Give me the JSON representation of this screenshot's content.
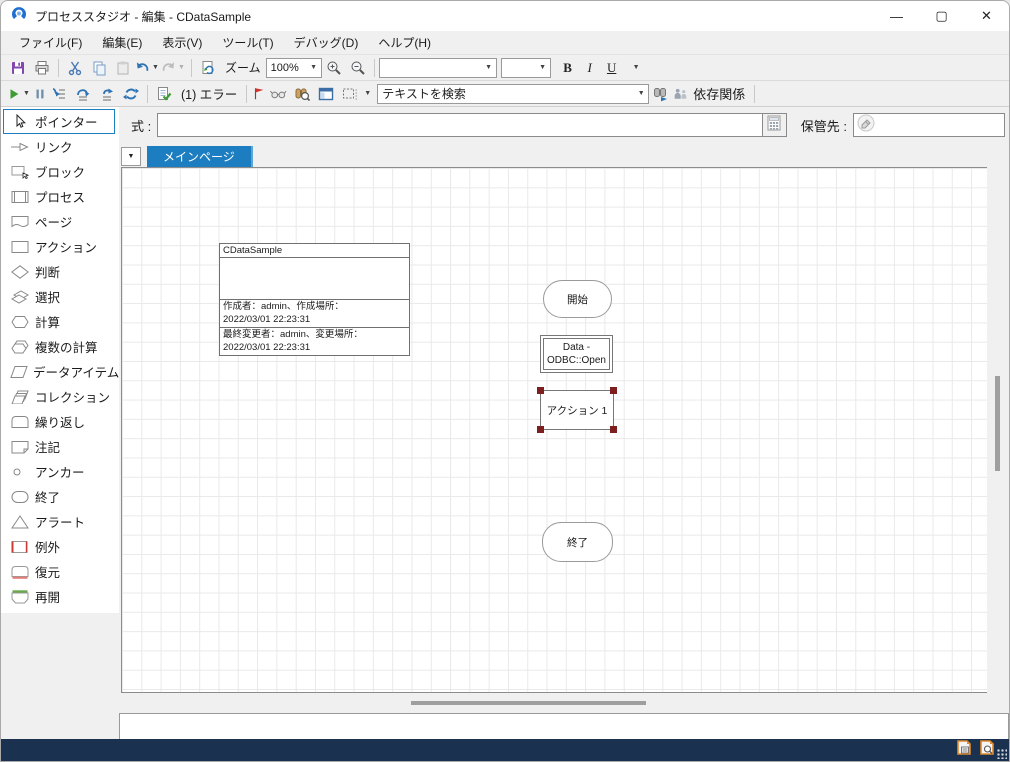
{
  "window": {
    "title": "プロセススタジオ  - 編集 - CDataSample",
    "controls": {
      "minimize": "—",
      "maximize": "▢",
      "close": "✕"
    }
  },
  "menu": {
    "items": [
      "ファイル(F)",
      "編集(E)",
      "表示(V)",
      "ツール(T)",
      "デバッグ(D)",
      "ヘルプ(H)"
    ]
  },
  "toolbars": {
    "standard": {
      "zoom_label": "ズーム",
      "zoom_value": "100%",
      "font_value": "",
      "font_size_value": "",
      "bold_label": "B",
      "italic_label": "I",
      "underline_label": "U"
    },
    "debug": {
      "error_label": "(1)  エラー",
      "search_value": "テキストを検索",
      "dependencies_label": "依存関係"
    }
  },
  "expression_bar": {
    "label": "式 :",
    "value": "",
    "store_label": "保管先 :",
    "store_value": ""
  },
  "page_tabs": {
    "active_tab": "メインページ"
  },
  "toolbox": {
    "items": [
      {
        "label": "ポインター",
        "icon": "pointer-icon",
        "selected": true
      },
      {
        "label": "リンク",
        "icon": "link-icon",
        "selected": false
      },
      {
        "label": "ブロック",
        "icon": "block-icon",
        "selected": false
      },
      {
        "label": "プロセス",
        "icon": "process-icon",
        "selected": false
      },
      {
        "label": "ページ",
        "icon": "page-icon",
        "selected": false
      },
      {
        "label": "アクション",
        "icon": "action-icon",
        "selected": false
      },
      {
        "label": "判断",
        "icon": "decision-icon",
        "selected": false
      },
      {
        "label": "選択",
        "icon": "choice-icon",
        "selected": false
      },
      {
        "label": "計算",
        "icon": "calculation-icon",
        "selected": false
      },
      {
        "label": "複数の計算",
        "icon": "multi-calculation-icon",
        "selected": false
      },
      {
        "label": "データアイテム",
        "icon": "data-item-icon",
        "selected": false
      },
      {
        "label": "コレクション",
        "icon": "collection-icon",
        "selected": false
      },
      {
        "label": "繰り返し",
        "icon": "loop-icon",
        "selected": false
      },
      {
        "label": "注記",
        "icon": "note-icon",
        "selected": false
      },
      {
        "label": "アンカー",
        "icon": "anchor-icon",
        "selected": false
      },
      {
        "label": "終了",
        "icon": "end-icon",
        "selected": false
      },
      {
        "label": "アラート",
        "icon": "alert-icon",
        "selected": false
      },
      {
        "label": "例外",
        "icon": "exception-icon",
        "selected": false
      },
      {
        "label": "復元",
        "icon": "recover-icon",
        "selected": false
      },
      {
        "label": "再開",
        "icon": "resume-icon",
        "selected": false
      }
    ]
  },
  "canvas": {
    "process_info": {
      "title": "CDataSample",
      "created_line": "作成者：admin、作成場所：",
      "created_at": "2022/03/01 22:23:31",
      "modified_line": "最終変更者：admin、変更場所：",
      "modified_at": "2022/03/01 22:23:31"
    },
    "nodes": [
      {
        "type": "start",
        "label": "開始"
      },
      {
        "type": "action-stage",
        "label_line1": "Data -",
        "label_line2": "ODBC::Open"
      },
      {
        "type": "action-stage",
        "label": "アクション 1",
        "selected": true
      },
      {
        "type": "end",
        "label": "終了"
      }
    ]
  },
  "colors": {
    "accent_blue": "#1c7dc0",
    "tab_blue": "#1c7dc0",
    "statusbar_navy": "#1a3150",
    "selection_handle_red": "#7e1f1f",
    "save_purple": "#8447af",
    "play_green": "#3f9c35",
    "flag_red": "#d0342c",
    "status_icon_orange": "#e08a2e",
    "grid_line": "#e9e9e9"
  }
}
